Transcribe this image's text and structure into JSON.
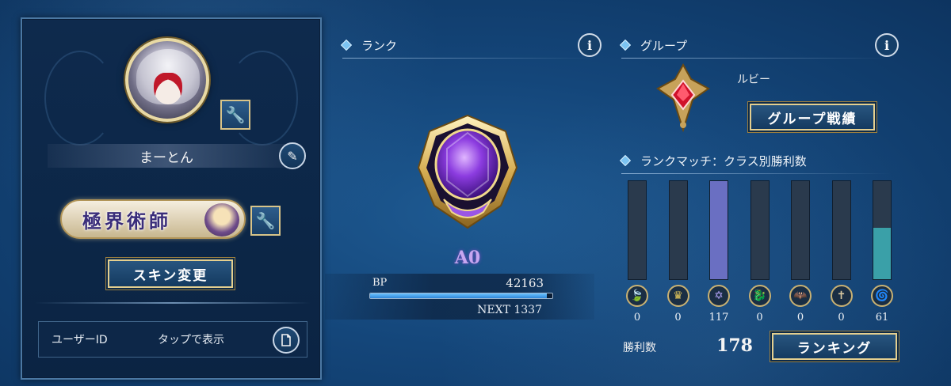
{
  "profile": {
    "player_name": "まーとん",
    "title": "極界術師",
    "skin_button": "スキン変更",
    "user_id_label": "ユーザーID",
    "user_id_value": "タップで表示"
  },
  "rank": {
    "section_title": "ランク",
    "rank_name": "A0",
    "bp_label": "BP",
    "bp_value": "42163",
    "bp_progress": 0.97,
    "next_label": "NEXT 1337"
  },
  "group": {
    "section_title": "グループ",
    "group_name": "ルビー",
    "group_record_button": "グループ戦績"
  },
  "rank_match": {
    "section_title": "ランクマッチ：クラス別勝利数",
    "wins_label": "勝利数",
    "wins_total": "178",
    "ranking_button": "ランキング"
  },
  "chart_data": {
    "type": "bar",
    "title": "ランクマッチ：クラス別勝利数",
    "categories": [
      "elf-class",
      "royal-class",
      "witch-class",
      "dragon-class",
      "vampire-class",
      "bishop-class",
      "nemesis-class"
    ],
    "values": [
      0,
      0,
      117,
      0,
      0,
      0,
      61
    ],
    "ylim": [
      0,
      117
    ],
    "colors": [
      "#6a6fc2",
      "#3aa0a8"
    ],
    "icons": [
      "leaf-icon",
      "crown-icon",
      "magic-circle-icon",
      "dragon-icon",
      "bat-icon",
      "cross-icon",
      "swirl-icon"
    ],
    "value_labels": [
      "0",
      "0",
      "117",
      "0",
      "0",
      "0",
      "61"
    ]
  }
}
